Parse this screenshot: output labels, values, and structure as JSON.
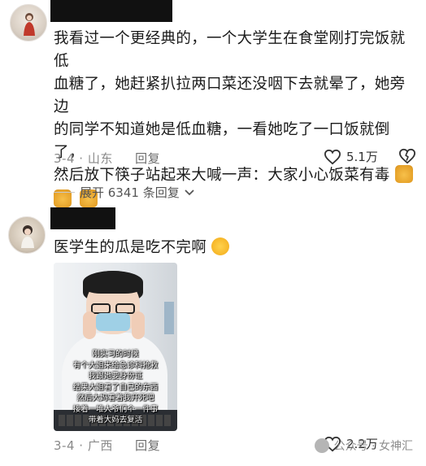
{
  "comment1": {
    "text_lines": [
      "我看过一个更经典的，一个大学生在食堂刚打完饭就低",
      "血糖了，她赶紧扒拉两口菜还没咽下去就晕了，她旁边",
      "的同学不知道她是低血糖，一看她吃了一口饭就倒了，",
      "然后放下筷子站起来大喊一声：大家小心饭菜有毒"
    ],
    "date": "3-4",
    "location": "山东",
    "reply_label": "回复",
    "likes": "5.1万",
    "expand_label": "展开 6341 条回复"
  },
  "comment2": {
    "text": "医学生的瓜是吃不完啊",
    "video_captions": [
      "刚实习的时候",
      "有个大姐来给急诊科抢救",
      "我跟她要身份证",
      "结果大姐看了自己的东西",
      "然后大妈看着我开死吧",
      "接着一堆大爷们个一件事",
      "带着大妈去复活"
    ],
    "date": "3-4",
    "location": "广西",
    "reply_label": "回复",
    "likes": "2.2万"
  },
  "watermark": {
    "text": "公众号 · 女神汇"
  },
  "icons": {
    "like": "heart-icon",
    "dislike": "broken-heart-icon",
    "expand": "chevron-down-icon",
    "wechat": "wechat-icon"
  },
  "colors": {
    "text": "#1a1a1a",
    "meta": "#8a8a8a",
    "redact": "#111111"
  }
}
